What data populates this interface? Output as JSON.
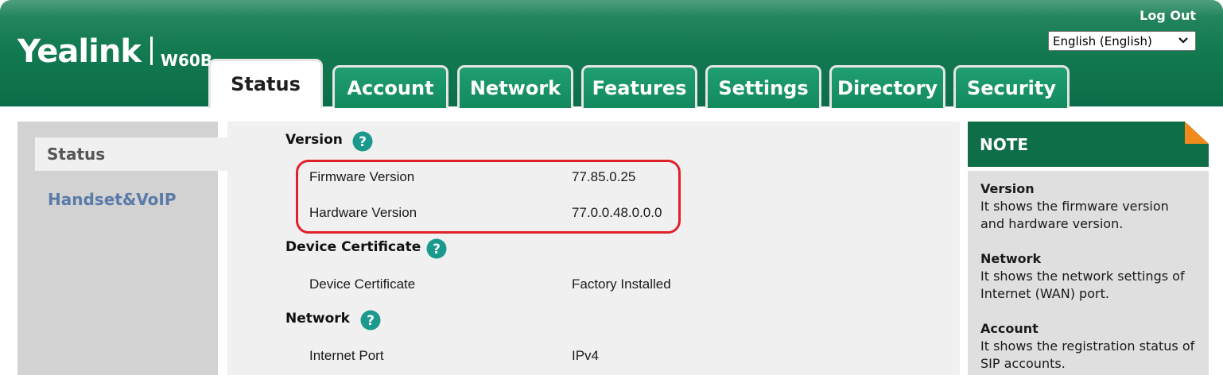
{
  "brand": {
    "name": "Yealink",
    "model": "W60B"
  },
  "header": {
    "logout_label": "Log Out",
    "language_selected": "English (English)"
  },
  "tabs": [
    {
      "label": "Status",
      "active": true
    },
    {
      "label": "Account"
    },
    {
      "label": "Network"
    },
    {
      "label": "Features"
    },
    {
      "label": "Settings"
    },
    {
      "label": "Directory"
    },
    {
      "label": "Security"
    }
  ],
  "sidebar": {
    "items": [
      {
        "label": "Status",
        "active": true
      },
      {
        "label": "Handset&VoIP"
      }
    ]
  },
  "main": {
    "sections": [
      {
        "title": "Version",
        "rows": [
          {
            "label": "Firmware Version",
            "value": "77.85.0.25"
          },
          {
            "label": "Hardware Version",
            "value": "77.0.0.48.0.0.0"
          }
        ]
      },
      {
        "title": "Device Certificate",
        "rows": [
          {
            "label": "Device Certificate",
            "value": "Factory Installed"
          }
        ]
      },
      {
        "title": "Network",
        "rows": [
          {
            "label": "Internet Port",
            "value": "IPv4"
          }
        ]
      }
    ]
  },
  "note": {
    "title": "NOTE",
    "blocks": [
      {
        "title": "Version",
        "lines": [
          "It shows the firmware version",
          "and hardware version."
        ]
      },
      {
        "title": "Network",
        "lines": [
          "It shows the network settings of",
          "Internet (WAN) port."
        ]
      },
      {
        "title": "Account",
        "lines": [
          "It shows the registration status of",
          "SIP accounts."
        ]
      }
    ]
  },
  "colors": {
    "header_green": "#137a51",
    "tab_green": "#1f9f70",
    "note_header": "#0e6e47",
    "help_teal": "#1a9a8c",
    "highlight_red": "#e0202b",
    "nav_link": "#5a7aa8",
    "note_corner": "#f08a1c"
  },
  "icons": {
    "help": "question-circle-icon",
    "dropdown": "chevron-down-icon",
    "note_corner": "folded-corner-icon"
  }
}
